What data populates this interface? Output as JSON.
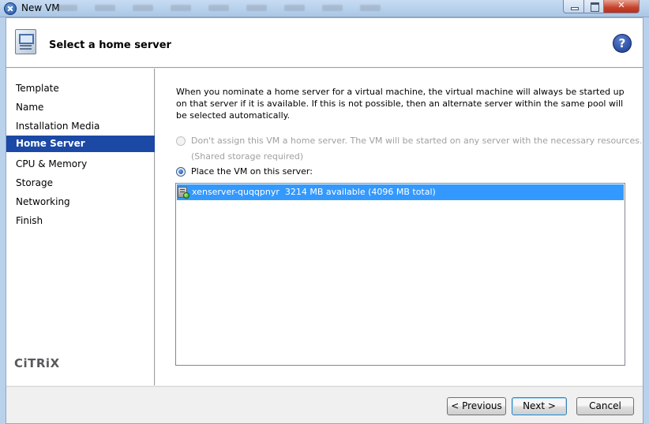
{
  "window": {
    "title": "New VM"
  },
  "header": {
    "title": "Select a home server",
    "help_symbol": "?"
  },
  "sidebar": {
    "items": [
      {
        "label": "Template"
      },
      {
        "label": "Name"
      },
      {
        "label": "Installation Media"
      },
      {
        "label": "Home Server",
        "active": true
      },
      {
        "label": "CPU & Memory"
      },
      {
        "label": "Storage"
      },
      {
        "label": "Networking"
      },
      {
        "label": "Finish"
      }
    ],
    "logo_text": "CiTRiX"
  },
  "content": {
    "description": "When you nominate a home server for a virtual machine, the virtual machine will always be started up on that server if it is available. If this is not possible, then an alternate server within the same pool will be selected automatically.",
    "option_no_home": {
      "label": "Don't assign this VM a home server. The VM will be started on any server with the necessary resources.",
      "sublabel": "(Shared storage required)",
      "enabled": false,
      "selected": false
    },
    "option_place": {
      "label": "Place the VM on this server:",
      "selected": true
    },
    "servers": [
      {
        "name": "xenserver-quqqpnyr",
        "memory": "3214 MB available (4096 MB total)",
        "status": "online",
        "selected": true
      }
    ]
  },
  "footer": {
    "previous_label": "< Previous",
    "next_label": "Next >",
    "cancel_label": "Cancel"
  },
  "colors": {
    "nav_active": "#1b49a5",
    "list_selection": "#3399ff",
    "status_online": "#1e9a0f"
  }
}
